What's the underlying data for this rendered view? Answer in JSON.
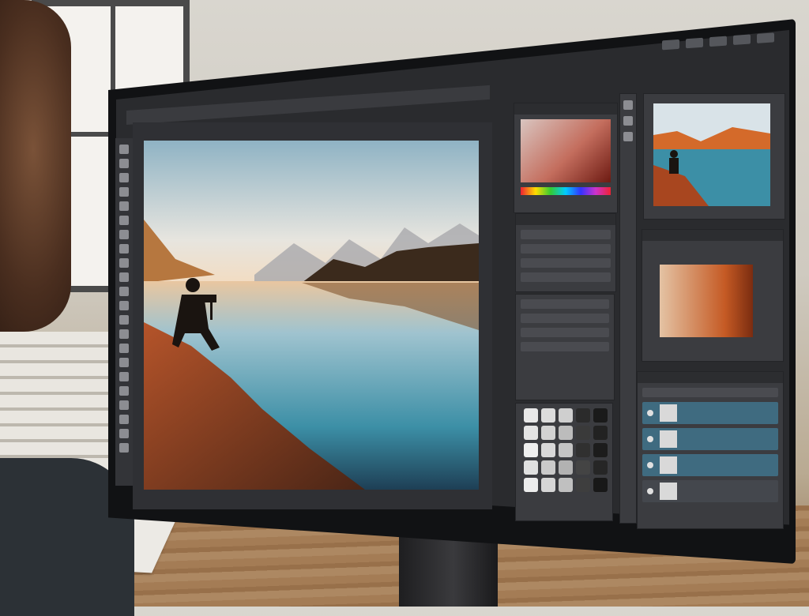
{
  "app": {
    "menu": [
      "",
      "",
      "",
      "",
      "",
      "",
      "",
      "",
      "",
      ""
    ]
  },
  "panels": {
    "color_title": "",
    "properties_rows": [
      "",
      "",
      "",
      ""
    ],
    "adjust_rows": [
      "",
      "",
      "",
      ""
    ],
    "layers_title": "",
    "layers": [
      "",
      "",
      "",
      ""
    ]
  },
  "colors": {
    "ui_dark": "#2a2b2e",
    "panel": "#3b3c40",
    "layer_selected": "#3f6b80",
    "sky_top": "#8fb3c4",
    "water": "#3c8fa6",
    "sunset": "#d46a2a"
  },
  "swatches": [
    "#e8e8e8",
    "#dcdcdc",
    "#cfcfcf",
    "#2b2b2b",
    "#1a1a1a",
    "#e4e4e4",
    "#d2d2d2",
    "#bcbcbc",
    "#3a3a3a",
    "#222222",
    "#efefef",
    "#d8d8d8",
    "#c4c4c4",
    "#303030",
    "#1c1c1c",
    "#e0e0e0",
    "#cacaca",
    "#b2b2b2",
    "#444444",
    "#262626",
    "#ececec",
    "#d6d6d6",
    "#c0c0c0",
    "#3e3e3e",
    "#181818"
  ]
}
